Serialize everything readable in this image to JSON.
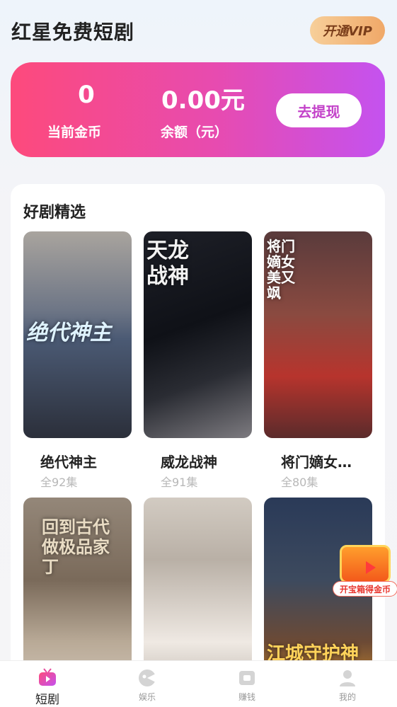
{
  "header": {
    "title": "红星免费短剧",
    "vip_button": "开通VIP"
  },
  "wallet": {
    "coins_value": "0",
    "coins_label": "当前金币",
    "balance_value": "0.00元",
    "balance_label": "余额（元）",
    "withdraw_button": "去提现"
  },
  "section": {
    "title": "好剧精选",
    "items": [
      {
        "title": "绝代神主",
        "episodes": "全92集",
        "poster_text": "绝代神主"
      },
      {
        "title": "威龙战神",
        "episodes": "全91集",
        "poster_text": "天龙战神"
      },
      {
        "title": "将门嫡女…",
        "episodes": "全80集",
        "poster_text": "将门嫡女美又飒"
      },
      {
        "title": "",
        "episodes": "",
        "poster_text": "回到古代做极品家丁"
      },
      {
        "title": "",
        "episodes": "",
        "poster_text": ""
      },
      {
        "title": "",
        "episodes": "",
        "poster_text": "江城守护神"
      }
    ]
  },
  "float_treasure": {
    "label": "开宝箱得金币"
  },
  "tabbar": {
    "tabs": [
      {
        "label": "短剧",
        "icon": "tv-icon",
        "active": true
      },
      {
        "label": "娱乐",
        "icon": "game-icon",
        "active": false
      },
      {
        "label": "赚钱",
        "icon": "wallet-icon",
        "active": false
      },
      {
        "label": "我的",
        "icon": "user-icon",
        "active": false
      }
    ]
  },
  "colors": {
    "accent": "#fd4a7c",
    "accent2": "#c452ef",
    "vip": "#f0a868"
  }
}
